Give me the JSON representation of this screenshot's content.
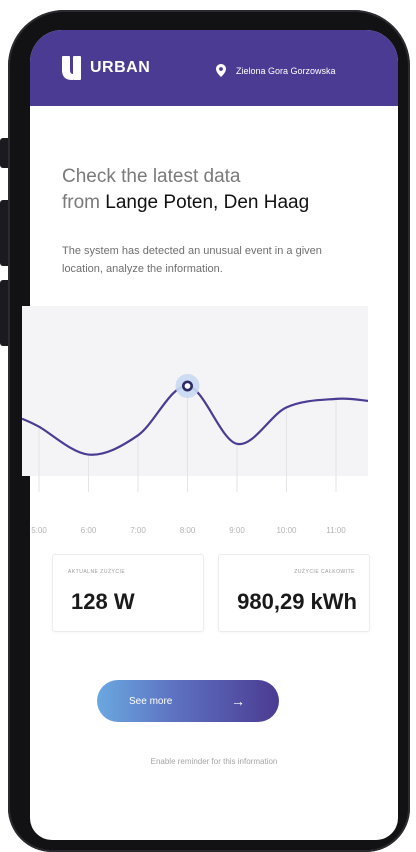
{
  "header": {
    "brand": "URBAN",
    "location": "Zielona Gora Gorzowska",
    "color": "#4b3b92"
  },
  "headline": {
    "prefix": "Check the latest data",
    "from_word": "from",
    "place": "Lange Poten, Den Haag"
  },
  "description": "The system has detected an unusual event in a given location, analyze the information.",
  "chart_data": {
    "type": "line",
    "x": [
      "5:00",
      "6:00",
      "7:00",
      "8:00",
      "9:00",
      "10:00",
      "11:00"
    ],
    "values": [
      2.3,
      1.0,
      1.9,
      4.2,
      1.5,
      3.2,
      3.6
    ],
    "highlight_index": 3,
    "ylim": [
      0,
      7
    ],
    "line_color": "#4b3b92",
    "marker_color": "#2e2a66",
    "grid": false
  },
  "cards": [
    {
      "label": "AKTUALNE ZUŻYCIE",
      "value": "128 W"
    },
    {
      "label": "ZUŻYCIE CAŁKOWITE",
      "value": "980,29 kWh"
    }
  ],
  "cta": {
    "label": "See more",
    "arrow": "→",
    "icon": "arrow-right-icon"
  },
  "reminder": "Enable reminder for this information"
}
